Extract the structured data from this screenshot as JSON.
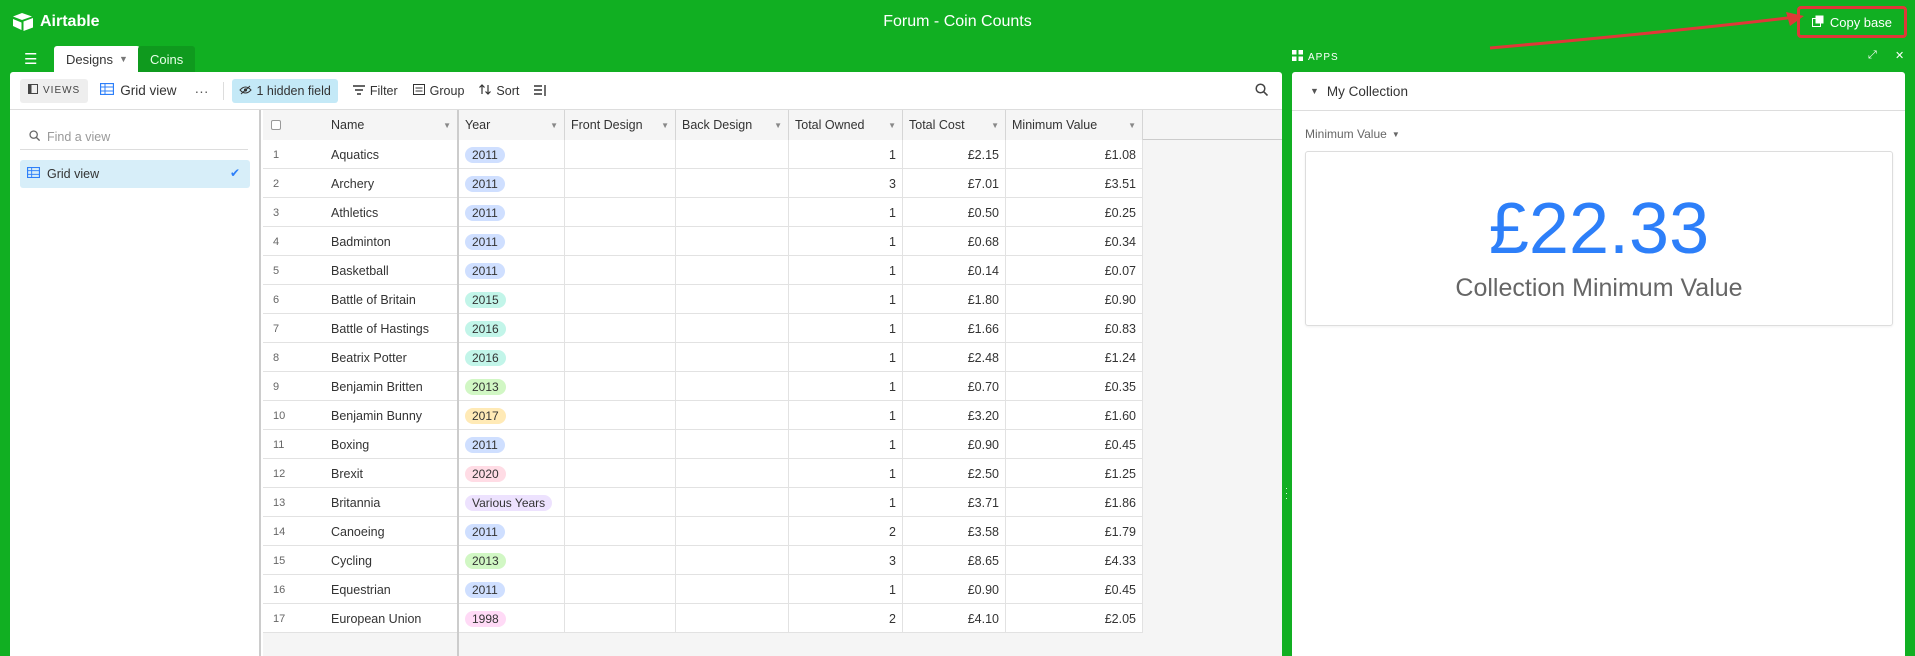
{
  "app": {
    "name": "Airtable",
    "base_title": "Forum - Coin Counts",
    "copy_base": "Copy base"
  },
  "colors": {
    "accent_green": "#11af22",
    "annotation_red": "#e03838",
    "summary_blue": "#2d7ff9"
  },
  "tabs": [
    {
      "label": "Designs"
    },
    {
      "label": "Coins"
    }
  ],
  "toolbar": {
    "views": "VIEWS",
    "view_name": "Grid view",
    "hidden_fields": "1 hidden field",
    "filter": "Filter",
    "group": "Group",
    "sort": "Sort"
  },
  "sidebar": {
    "find_placeholder": "Find a view",
    "items": [
      {
        "label": "Grid view"
      }
    ]
  },
  "table": {
    "columns": [
      "Name",
      "Year",
      "Front Design",
      "Back Design",
      "Total Owned",
      "Total Cost",
      "Minimum Value"
    ],
    "rows": [
      {
        "num": "1",
        "name": "Aquatics",
        "year": "2011",
        "owned": "1",
        "cost": "£2.15",
        "min": "£1.08"
      },
      {
        "num": "2",
        "name": "Archery",
        "year": "2011",
        "owned": "3",
        "cost": "£7.01",
        "min": "£3.51"
      },
      {
        "num": "3",
        "name": "Athletics",
        "year": "2011",
        "owned": "1",
        "cost": "£0.50",
        "min": "£0.25"
      },
      {
        "num": "4",
        "name": "Badminton",
        "year": "2011",
        "owned": "1",
        "cost": "£0.68",
        "min": "£0.34"
      },
      {
        "num": "5",
        "name": "Basketball",
        "year": "2011",
        "owned": "1",
        "cost": "£0.14",
        "min": "£0.07"
      },
      {
        "num": "6",
        "name": "Battle of Britain",
        "year": "2015",
        "owned": "1",
        "cost": "£1.80",
        "min": "£0.90"
      },
      {
        "num": "7",
        "name": "Battle of Hastings",
        "year": "2016",
        "owned": "1",
        "cost": "£1.66",
        "min": "£0.83"
      },
      {
        "num": "8",
        "name": "Beatrix Potter",
        "year": "2016",
        "owned": "1",
        "cost": "£2.48",
        "min": "£1.24"
      },
      {
        "num": "9",
        "name": "Benjamin Britten",
        "year": "2013",
        "owned": "1",
        "cost": "£0.70",
        "min": "£0.35"
      },
      {
        "num": "10",
        "name": "Benjamin Bunny",
        "year": "2017",
        "owned": "1",
        "cost": "£3.20",
        "min": "£1.60"
      },
      {
        "num": "11",
        "name": "Boxing",
        "year": "2011",
        "owned": "1",
        "cost": "£0.90",
        "min": "£0.45"
      },
      {
        "num": "12",
        "name": "Brexit",
        "year": "2020",
        "owned": "1",
        "cost": "£2.50",
        "min": "£1.25"
      },
      {
        "num": "13",
        "name": "Britannia",
        "year": "Various Years",
        "owned": "1",
        "cost": "£3.71",
        "min": "£1.86"
      },
      {
        "num": "14",
        "name": "Canoeing",
        "year": "2011",
        "owned": "2",
        "cost": "£3.58",
        "min": "£1.79"
      },
      {
        "num": "15",
        "name": "Cycling",
        "year": "2013",
        "owned": "3",
        "cost": "£8.65",
        "min": "£4.33"
      },
      {
        "num": "16",
        "name": "Equestrian",
        "year": "2011",
        "owned": "1",
        "cost": "£0.90",
        "min": "£0.45"
      },
      {
        "num": "17",
        "name": "European Union",
        "year": "1998",
        "owned": "2",
        "cost": "£4.10",
        "min": "£2.05"
      }
    ],
    "year_colors": {
      "2011": "#cfdfff",
      "2013": "#d1f7c4",
      "2015": "#c2f5e9",
      "2016": "#c2f5e9",
      "2017": "#ffeab6",
      "2020": "#ffdce5",
      "Various Years": "#ede2fe",
      "1998": "#ffdaf6"
    }
  },
  "apps": {
    "label": "APPS",
    "block_title": "My Collection",
    "field": "Minimum Value",
    "value": "£22.33",
    "caption": "Collection Minimum Value"
  }
}
